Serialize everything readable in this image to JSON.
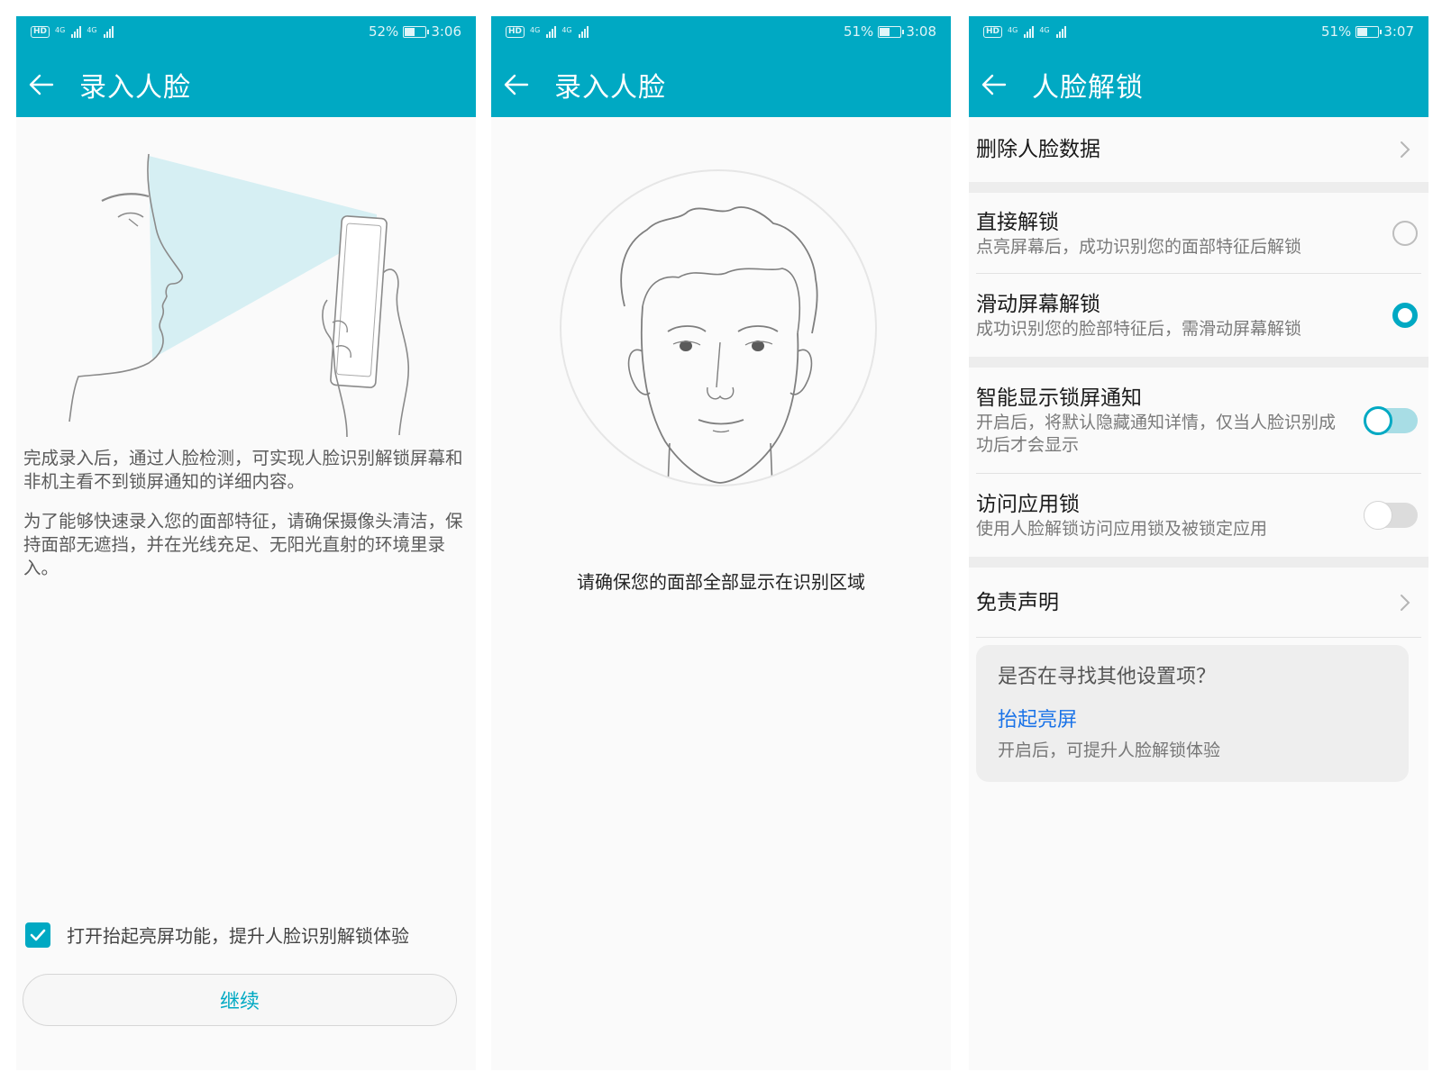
{
  "theme": {
    "accent": "#00a9c3"
  },
  "screens": [
    {
      "status": {
        "battery": "52%",
        "time": "3:06",
        "hd": "HD",
        "net1": "4G",
        "net2": "4G"
      },
      "title": "录入人脸",
      "intro_1": "完成录入后，通过人脸检测，可实现人脸识别解锁屏幕和非机主看不到锁屏通知的详细内容。",
      "intro_2": "为了能够快速录入您的面部特征，请确保摄像头清洁，保持面部无遮挡，并在光线充足、无阳光直射的环境里录入。",
      "checkbox_label": "打开抬起亮屏功能，提升人脸识别解锁体验",
      "checkbox_checked": true,
      "continue_label": "继续"
    },
    {
      "status": {
        "battery": "51%",
        "time": "3:08",
        "hd": "HD",
        "net1": "4G",
        "net2": "4G"
      },
      "title": "录入人脸",
      "hint": "请确保您的面部全部显示在识别区域"
    },
    {
      "status": {
        "battery": "51%",
        "time": "3:07",
        "hd": "HD",
        "net1": "4G",
        "net2": "4G"
      },
      "title": "人脸解锁",
      "delete_face": "删除人脸数据",
      "direct_unlock": {
        "title": "直接解锁",
        "sub": "点亮屏幕后，成功识别您的面部特征后解锁",
        "selected": false
      },
      "swipe_unlock": {
        "title": "滑动屏幕解锁",
        "sub": "成功识别您的脸部特征后，需滑动屏幕解锁",
        "selected": true
      },
      "smart_notify": {
        "title": "智能显示锁屏通知",
        "sub": "开启后，将默认隐藏通知详情，仅当人脸识别成功后才会显示",
        "on": true
      },
      "app_lock": {
        "title": "访问应用锁",
        "sub": "使用人脸解锁访问应用锁及被锁定应用",
        "on": false
      },
      "disclaimer": "免责声明",
      "tip": {
        "question": "是否在寻找其他设置项？",
        "link": "抬起亮屏",
        "desc": "开启后，可提升人脸解锁体验"
      }
    }
  ]
}
